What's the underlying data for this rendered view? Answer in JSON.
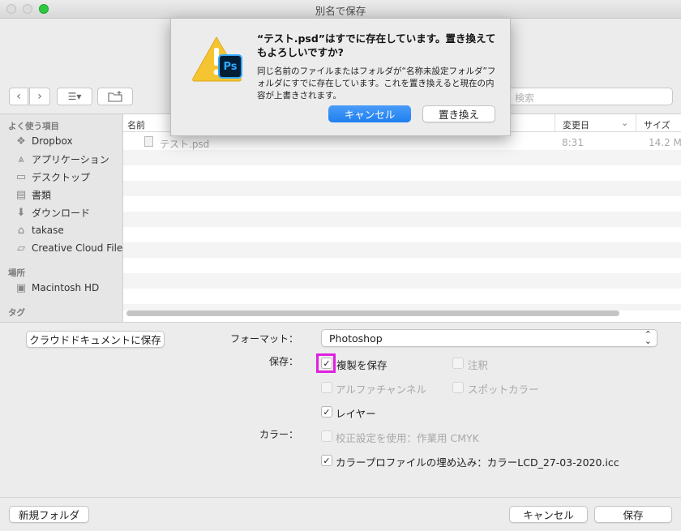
{
  "window": {
    "title": "別名で保存"
  },
  "toolbar": {
    "search_placeholder": "検索"
  },
  "sidebar": {
    "favorites_header": "よく使う項目",
    "favorites": [
      {
        "label": "Dropbox",
        "icon": "dropbox-icon"
      },
      {
        "label": "アプリケーション",
        "icon": "applications-icon"
      },
      {
        "label": "デスクトップ",
        "icon": "desktop-icon"
      },
      {
        "label": "書類",
        "icon": "documents-icon"
      },
      {
        "label": "ダウンロード",
        "icon": "downloads-icon"
      },
      {
        "label": "takase",
        "icon": "home-icon"
      },
      {
        "label": "Creative Cloud Files",
        "icon": "folder-icon"
      }
    ],
    "locations_header": "場所",
    "locations": [
      {
        "label": "Macintosh HD",
        "icon": "disk-icon"
      }
    ],
    "tags_header": "タグ"
  },
  "filelist": {
    "columns": {
      "name": "名前",
      "date": "変更日",
      "size": "サイズ"
    },
    "rows": [
      {
        "name": "テスト.psd",
        "date": "8:31",
        "size": "14.2 MB"
      }
    ]
  },
  "options": {
    "cloud_button": "クラウドドキュメントに保存",
    "format_label": "フォーマット：",
    "format_value": "Photoshop",
    "save_label": "保存：",
    "color_label": "カラー：",
    "checkboxes": {
      "copy": {
        "label": "複製を保存",
        "checked": true
      },
      "notes": {
        "label": "注釈",
        "checked": false
      },
      "alpha": {
        "label": "アルファチャンネル",
        "checked": false
      },
      "spot": {
        "label": "スポットカラー",
        "checked": false
      },
      "layers": {
        "label": "レイヤー",
        "checked": true
      },
      "proof": {
        "label": "校正設定を使用：作業用 CMYK",
        "checked": false
      },
      "profile": {
        "label": "カラープロファイルの埋め込み：カラーLCD_27-03-2020.icc",
        "checked": true
      }
    },
    "checkmark": "✓"
  },
  "bottom": {
    "new_folder": "新規フォルダ",
    "cancel": "キャンセル",
    "save": "保存"
  },
  "alert": {
    "title": "“テスト.psd”はすでに存在しています。置き換えてもよろしいですか?",
    "message": "同じ名前のファイルまたはフォルダが“名称未設定フォルダ”フォルダにすでに存在しています。これを置き換えると現在の内容が上書きされます。",
    "cancel": "キャンセル",
    "replace": "置き換え",
    "ps_badge": "Ps"
  },
  "colors": {
    "accent": "#2f8cf6",
    "highlight": "#e020e0",
    "ps_blue": "#31a8ff"
  }
}
